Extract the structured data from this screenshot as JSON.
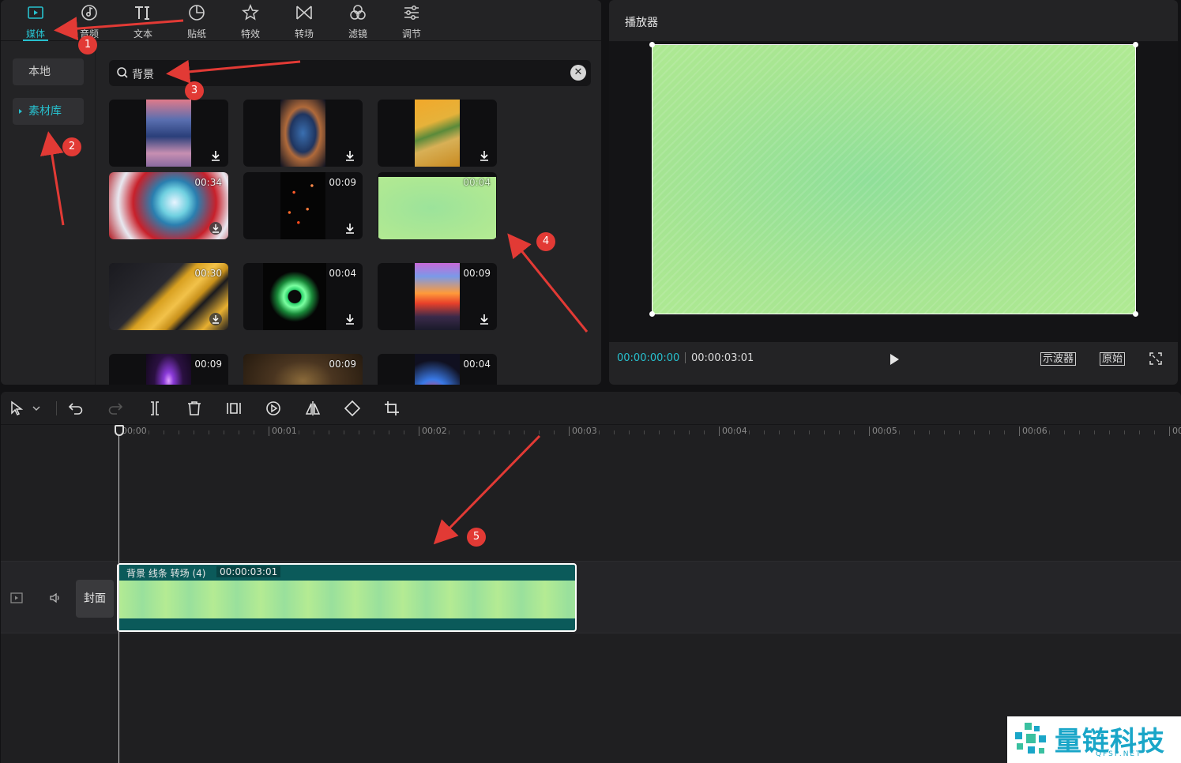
{
  "tabs": [
    {
      "label": "媒体",
      "icon": "media-icon",
      "active": true
    },
    {
      "label": "音频",
      "icon": "audio-icon"
    },
    {
      "label": "文本",
      "icon": "text-icon"
    },
    {
      "label": "贴纸",
      "icon": "sticker-icon"
    },
    {
      "label": "特效",
      "icon": "effects-icon"
    },
    {
      "label": "转场",
      "icon": "transition-icon"
    },
    {
      "label": "滤镜",
      "icon": "filter-icon"
    },
    {
      "label": "调节",
      "icon": "adjust-icon"
    }
  ],
  "sidebar": {
    "items": [
      {
        "label": "本地"
      },
      {
        "label": "素材库",
        "active": true
      }
    ]
  },
  "search": {
    "value": "背景"
  },
  "grid": {
    "tiles": [
      {
        "duration": ""
      },
      {
        "duration": ""
      },
      {
        "duration": ""
      },
      {
        "duration": "00:34"
      },
      {
        "duration": "00:09"
      },
      {
        "duration": "00:04"
      },
      {
        "duration": "00:30"
      },
      {
        "duration": "00:04"
      },
      {
        "duration": "00:09"
      },
      {
        "duration": "00:09"
      },
      {
        "duration": "00:09"
      },
      {
        "duration": "00:04"
      }
    ]
  },
  "player": {
    "title": "播放器",
    "current_time": "00:00:00:00",
    "total_time": "00:00:03:01",
    "scope_label": "示波器",
    "original_label": "原始"
  },
  "timeline": {
    "ruler": [
      "00:00",
      "00:01",
      "00:02",
      "00:03",
      "00:04",
      "00:05",
      "00:06",
      "00"
    ],
    "cover_label": "封面",
    "clip": {
      "name": "背景 线条 转场 (4)",
      "duration": "00:00:03:01"
    }
  },
  "annotations": [
    "1",
    "2",
    "3",
    "4",
    "5"
  ],
  "watermark": {
    "text": "量链科技",
    "sub": "QFSP.NET"
  },
  "colors": {
    "accent": "#27c1cf",
    "annotation": "#e23a35",
    "clip": "#0b5a5a",
    "green_bg": "#a6e592"
  }
}
